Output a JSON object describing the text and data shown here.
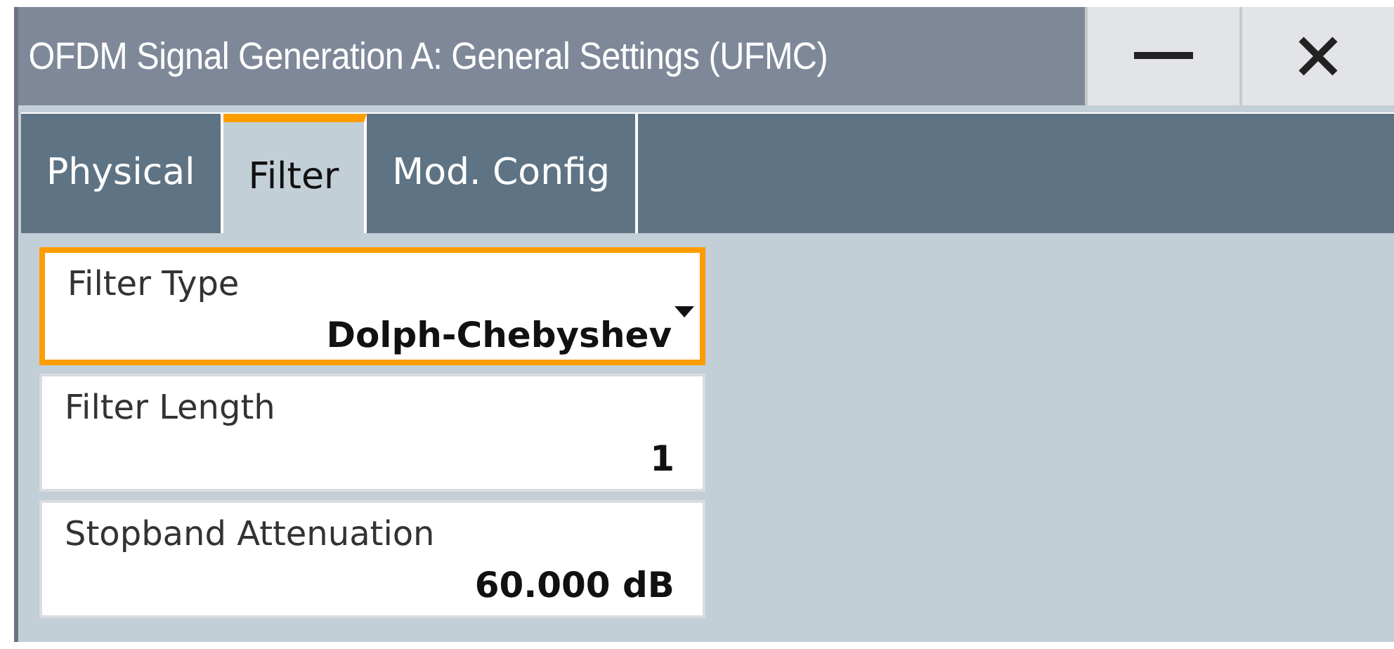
{
  "window": {
    "title": "OFDM Signal Generation A: General Settings (UFMC)"
  },
  "tabs": [
    {
      "label": "Physical",
      "selected": false
    },
    {
      "label": "Filter",
      "selected": true
    },
    {
      "label": "Mod. Config",
      "selected": false
    }
  ],
  "fields": [
    {
      "kind": "dropdown",
      "label": "Filter Type",
      "value": "Dolph-Chebyshev",
      "focused": true
    },
    {
      "kind": "number",
      "label": "Filter Length",
      "value": "1",
      "focused": false
    },
    {
      "kind": "number",
      "label": "Stopband Attenuation",
      "value": "60.000 dB",
      "focused": false
    }
  ]
}
